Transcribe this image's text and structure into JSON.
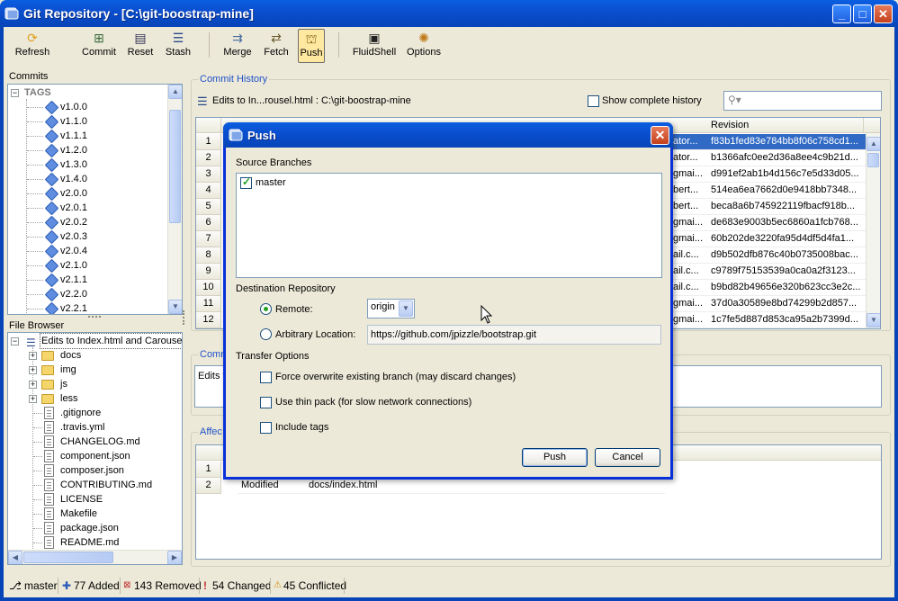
{
  "window": {
    "title": "Git Repository - [C:\\git-boostrap-mine]"
  },
  "toolbar": {
    "refresh": "Refresh",
    "commit": "Commit",
    "reset": "Reset",
    "stash": "Stash",
    "merge": "Merge",
    "fetch": "Fetch",
    "push": "Push",
    "fluidshell": "FluidShell",
    "options": "Options"
  },
  "commits_panel": {
    "label": "Commits",
    "tags_label": "TAGS",
    "tags": [
      "v1.0.0",
      "v1.1.0",
      "v1.1.1",
      "v1.2.0",
      "v1.3.0",
      "v1.4.0",
      "v2.0.0",
      "v2.0.1",
      "v2.0.2",
      "v2.0.3",
      "v2.0.4",
      "v2.1.0",
      "v2.1.1",
      "v2.2.0",
      "v2.2.1"
    ]
  },
  "file_browser": {
    "label": "File Browser",
    "root": "Edits to Index.html and Carouse",
    "folders": [
      "docs",
      "img",
      "js",
      "less"
    ],
    "files": [
      ".gitignore",
      ".travis.yml",
      "CHANGELOG.md",
      "component.json",
      "composer.json",
      "CONTRIBUTING.md",
      "LICENSE",
      "Makefile",
      "package.json",
      "README.md"
    ]
  },
  "commit_history": {
    "title": "Commit History",
    "path": "Edits to In...rousel.html : C:\\git-boostrap-mine",
    "show_complete": "Show complete history",
    "revision_header": "Revision",
    "rows": [
      {
        "n": "1",
        "author": "ator...",
        "rev": "f83b1fed83e784bb8f06c758cd1..."
      },
      {
        "n": "2",
        "author": "ator...",
        "rev": "b1366afc0ee2d36a8ee4c9b21d..."
      },
      {
        "n": "3",
        "author": "gmai...",
        "rev": "d991ef2ab1b4d156c7e5d33d05..."
      },
      {
        "n": "4",
        "author": "bert...",
        "rev": "514ea6ea7662d0e9418bb7348..."
      },
      {
        "n": "5",
        "author": "bert...",
        "rev": "beca8a6b745922119fbacf918b..."
      },
      {
        "n": "6",
        "author": "gmai...",
        "rev": "de683e9003b5ec6860a1fcb768..."
      },
      {
        "n": "7",
        "author": "gmai...",
        "rev": "60b202de3220fa95d4df5d4fa1..."
      },
      {
        "n": "8",
        "author": "ail.c...",
        "rev": "d9b502dfb876c40b0735008bac..."
      },
      {
        "n": "9",
        "author": "ail.c...",
        "rev": "c9789f75153539a0ca0a2f3123..."
      },
      {
        "n": "10",
        "author": "ail.c...",
        "rev": "b9bd82b49656e320b623cc3e2c..."
      },
      {
        "n": "11",
        "author": "gmai...",
        "rev": "37d0a30589e8bd74299b2d857..."
      },
      {
        "n": "12",
        "author": "gmai...",
        "rev": "1c7fe5d887d853ca95a2b7399d..."
      }
    ]
  },
  "commit_message": {
    "title": "Comm",
    "text": "Edits t"
  },
  "affected": {
    "title": "Affec",
    "rows": [
      {
        "n": "1",
        "status": "",
        "path": ""
      },
      {
        "n": "2",
        "status": "Modified",
        "path": "docs/index.html"
      }
    ]
  },
  "status": {
    "branch": "master",
    "added": "77 Added",
    "removed": "143 Removed",
    "changed": "54 Changed",
    "conflicted": "45 Conflicted"
  },
  "dialog": {
    "title": "Push",
    "source_branches_label": "Source Branches",
    "branches": [
      "master"
    ],
    "destination_label": "Destination Repository",
    "remote_label": "Remote:",
    "remote_value": "origin",
    "arbitrary_label": "Arbitrary Location:",
    "arbitrary_value": "https://github.com/jpizzle/bootstrap.git",
    "transfer_label": "Transfer Options",
    "opt_force": "Force overwrite existing branch (may discard changes)",
    "opt_thin": "Use thin pack (for slow network connections)",
    "opt_tags": "Include tags",
    "push_btn": "Push",
    "cancel_btn": "Cancel"
  },
  "colors": {
    "accent": "#0a5fe0",
    "selection": "#316ac5",
    "group_title": "#2152c9"
  }
}
